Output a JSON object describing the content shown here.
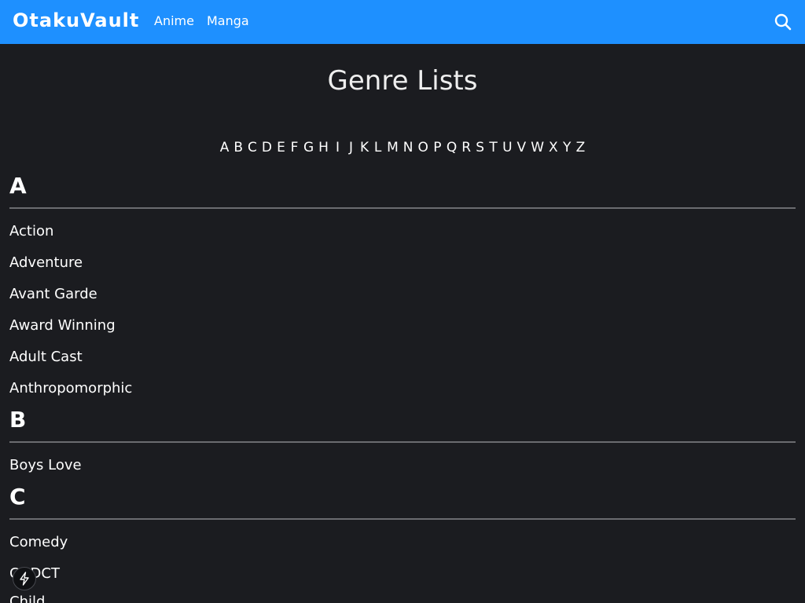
{
  "header": {
    "logo": "OtakuVault",
    "nav": [
      "Anime",
      "Manga"
    ],
    "search_icon": "search-icon"
  },
  "page": {
    "title": "Genre Lists"
  },
  "alphabet": [
    "A",
    "B",
    "C",
    "D",
    "E",
    "F",
    "G",
    "H",
    "I",
    "J",
    "K",
    "L",
    "M",
    "N",
    "O",
    "P",
    "Q",
    "R",
    "S",
    "T",
    "U",
    "V",
    "W",
    "X",
    "Y",
    "Z"
  ],
  "sections": [
    {
      "letter": "A",
      "genres": [
        "Action",
        "Adventure",
        "Avant Garde",
        "Award Winning",
        "Adult Cast",
        "Anthropomorphic"
      ]
    },
    {
      "letter": "B",
      "genres": [
        "Boys Love"
      ]
    },
    {
      "letter": "C",
      "genres": [
        "Comedy",
        "CGDCT",
        "Child"
      ]
    }
  ],
  "floating_button_icon": "bolt-icon",
  "colors": {
    "header_bg": "#1e90ff",
    "page_bg": "#1b1c20",
    "text": "#ffffff",
    "rule": "#6b6c70"
  }
}
